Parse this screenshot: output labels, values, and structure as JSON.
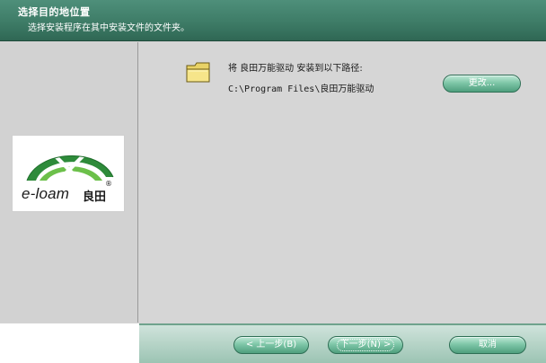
{
  "header": {
    "title": "选择目的地位置",
    "subtitle": "选择安装程序在其中安装文件的文件夹。"
  },
  "logo": {
    "word": "e-loam",
    "cn": "良田",
    "reg": "®"
  },
  "install": {
    "message": "将 良田万能驱动 安装到以下路径:",
    "path": "C:\\Program Files\\良田万能驱动"
  },
  "buttons": {
    "change": "更改...",
    "back": "< 上一步(B)",
    "next": "下一步(N) >",
    "cancel": "取消"
  },
  "icons": {
    "folder": "folder-icon",
    "logo": "e-loam-logo"
  },
  "colors": {
    "header_bg": "#3e7c67",
    "button_green": "#7fc7a8",
    "logo_green": "#2e8b3a"
  }
}
